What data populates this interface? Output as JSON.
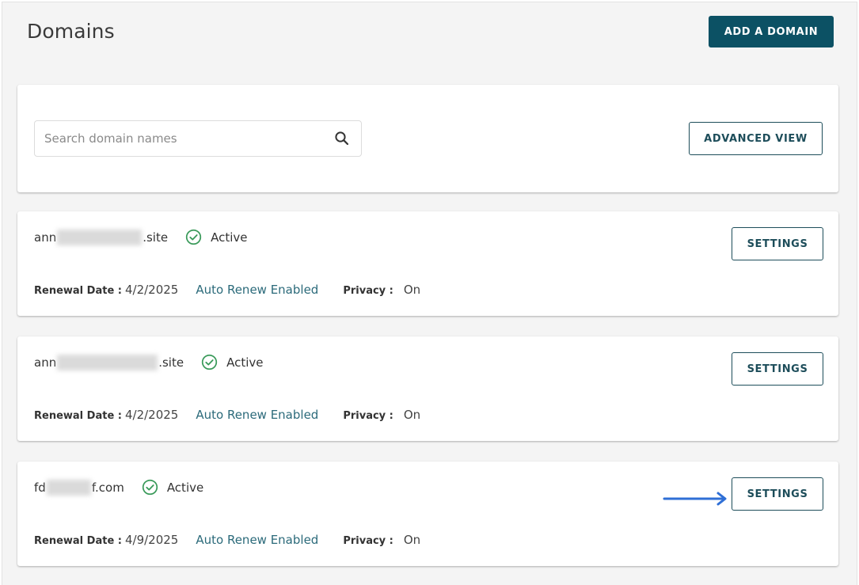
{
  "header": {
    "title": "Domains",
    "add_domain_label": "ADD A DOMAIN"
  },
  "search": {
    "placeholder": "Search domain names",
    "value": "",
    "advanced_view_label": "ADVANCED VIEW"
  },
  "labels": {
    "renewal_date": "Renewal Date :",
    "privacy": "Privacy :",
    "settings": "SETTINGS"
  },
  "domains": [
    {
      "name_prefix": "ann",
      "name_suffix": ".site",
      "name_obscured": true,
      "status": "Active",
      "renewal_date": "4/2/2025",
      "auto_renew": "Auto Renew Enabled",
      "privacy": "On"
    },
    {
      "name_prefix": "ann",
      "name_suffix": ".site",
      "name_obscured": true,
      "status": "Active",
      "renewal_date": "4/2/2025",
      "auto_renew": "Auto Renew Enabled",
      "privacy": "On"
    },
    {
      "name_prefix": "fd",
      "name_suffix": "f.com",
      "name_obscured": true,
      "status": "Active",
      "renewal_date": "4/9/2025",
      "auto_renew": "Auto Renew Enabled",
      "privacy": "On"
    }
  ],
  "annotation": {
    "type": "arrow",
    "points_to": "settings-button of third domain",
    "color": "#2f6fd6"
  },
  "colors": {
    "primary": "#0c5164",
    "success": "#3a9a5a",
    "link": "#2b6a7a",
    "background": "#f4f4f4"
  }
}
